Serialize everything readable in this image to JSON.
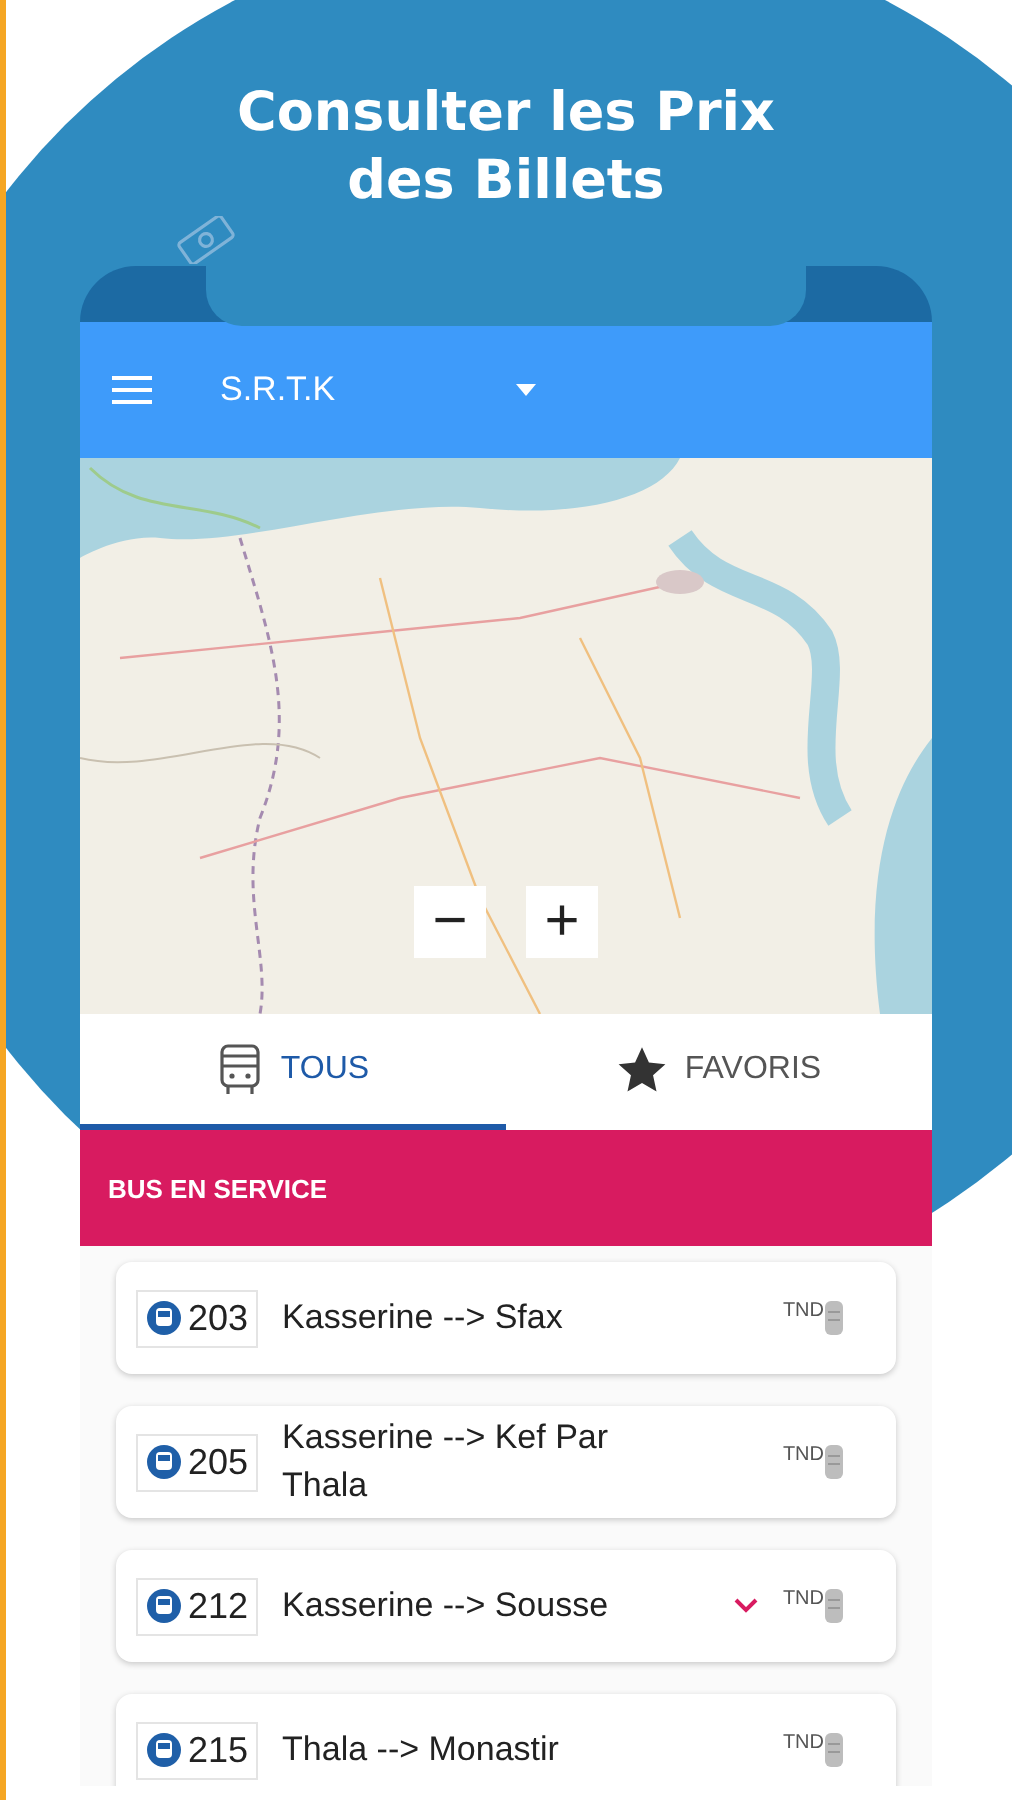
{
  "headline": "Consulter les Prix des Billets",
  "app_bar": {
    "title": "S.R.T.K"
  },
  "map": {
    "kind": "picture",
    "zoom_controls": [
      "−",
      "+"
    ]
  },
  "tabs": [
    {
      "label": "TOUS",
      "kind": "bus",
      "selected": true
    },
    {
      "label": "FAVORIS",
      "kind": "star",
      "selected": false
    }
  ],
  "section": {
    "title": "BUS EN SERVICE"
  },
  "routes": [
    {
      "number": "203",
      "name": "Kasserine --> Sfax",
      "currency": "TND",
      "highlighted": false
    },
    {
      "number": "205",
      "name": "Kasserine --> Kef Par Thala",
      "currency": "TND",
      "highlighted": false
    },
    {
      "number": "212",
      "name": "Kasserine --> Sousse",
      "currency": "TND",
      "highlighted": true
    },
    {
      "number": "215",
      "name": "Thala --> Monastir",
      "currency": "TND",
      "highlighted": false
    }
  ]
}
